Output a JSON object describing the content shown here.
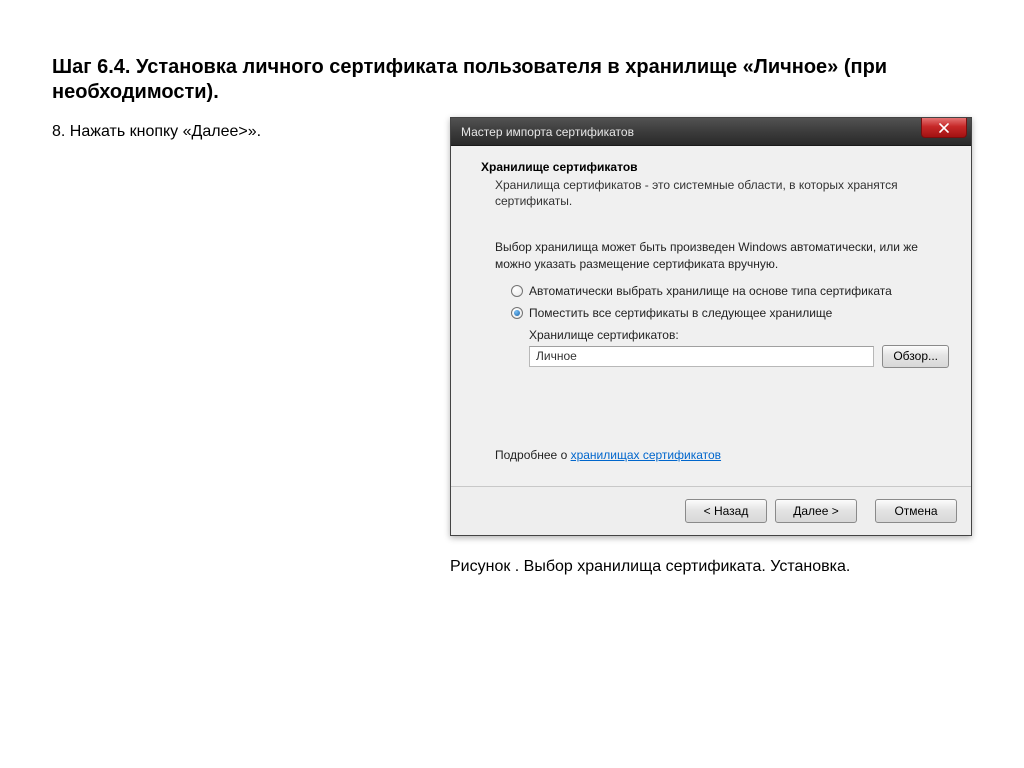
{
  "heading": "Шаг 6.4. Установка личного сертификата пользователя в хранилище «Личное» (при необходимости).",
  "instruction": "8. Нажать кнопку «Далее>».",
  "caption": "Рисунок . Выбор хранилища сертификата. Установка.",
  "wizard": {
    "title": "Мастер импорта сертификатов",
    "section_title": "Хранилище сертификатов",
    "section_desc": "Хранилища сертификатов - это системные области, в которых хранятся сертификаты.",
    "choice_intro": "Выбор хранилища может быть произведен Windows автоматически, или же можно указать размещение сертификата вручную.",
    "radio_auto": "Автоматически выбрать хранилище на основе типа сертификата",
    "radio_manual": "Поместить все сертификаты в следующее хранилище",
    "store_label": "Хранилище сертификатов:",
    "store_value": "Личное",
    "browse": "Обзор...",
    "learn_more_prefix": "Подробнее о ",
    "learn_more_link": "хранилищах сертификатов",
    "back": "< Назад",
    "next": "Далее >",
    "cancel": "Отмена"
  }
}
